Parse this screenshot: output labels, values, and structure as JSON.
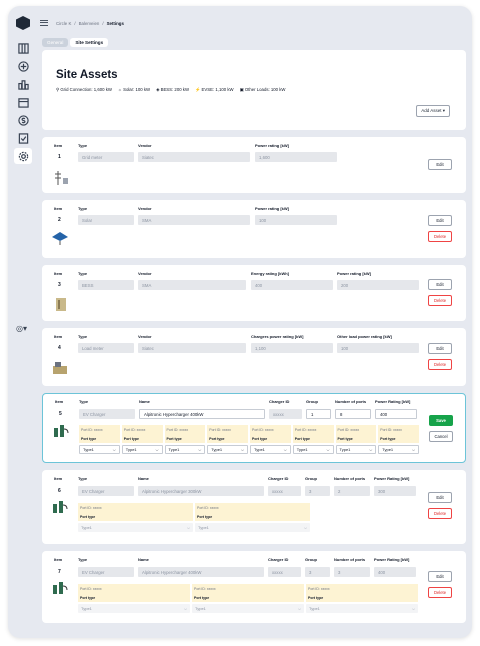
{
  "breadcrumb": {
    "a": "Circle K",
    "b": "Balerveien",
    "c": "Settings"
  },
  "tabs": [
    "General",
    "Site Settings"
  ],
  "site": {
    "title": "Site Assets",
    "grid": "Grid Connection: 1,600 kW",
    "solar": "Solar: 100 kW",
    "bess": "BESS: 200 kW",
    "evse": "EVSE: 1,100 kW",
    "other": "Other Loads: 100 kW",
    "add_asset": "Add Asset"
  },
  "labels": {
    "item": "Item",
    "type": "Type",
    "vendor": "Vendor",
    "name": "Name",
    "power": "Power rating [kW]",
    "energy": "Energy rating [kWh]",
    "chargers_power": "Chargers power rating [kW]",
    "other_power": "Other load power rating [kW]",
    "charger_id": "Charger ID",
    "group": "Group",
    "nports": "Number of ports",
    "power_cap": "Power Rating [kW]",
    "port_id": "Port ID: xxxxx",
    "port_type": "Port type",
    "type1": "Type1",
    "edit": "Edit",
    "delete": "Delete",
    "save": "Save",
    "cancel": "Cancel"
  },
  "assets": [
    {
      "item": "1",
      "type": "Grid meter",
      "vendor": "Siatec",
      "power": "1,600"
    },
    {
      "item": "2",
      "type": "Solar",
      "vendor": "SMA",
      "power": "100"
    },
    {
      "item": "3",
      "type": "BESS",
      "vendor": "SMA",
      "energy": "400",
      "power": "200"
    },
    {
      "item": "4",
      "type": "Load meter",
      "vendor": "Siatec",
      "chargers_power": "1,100",
      "other_power": "100"
    },
    {
      "item": "5",
      "type": "EV Charger",
      "name": "Alpitronic Hypercharger 400kW",
      "charger_id": "xxxxx",
      "group": "1",
      "ports": "8",
      "power": "400"
    },
    {
      "item": "6",
      "type": "EV Charger",
      "name": "Alpitronic Hypercharger 300kW",
      "charger_id": "xxxxx",
      "group": "3",
      "ports": "2",
      "power": "300"
    },
    {
      "item": "7",
      "type": "EV Charger",
      "name": "Alpitronic Hypercharger 400kW",
      "charger_id": "xxxxx",
      "group": "3",
      "ports": "3",
      "power": "400"
    }
  ],
  "colors": {
    "accent": "#16a34a",
    "danger": "#dc2626",
    "port_bg": "#fdf3d3",
    "highlight": "#6cc4d8"
  }
}
